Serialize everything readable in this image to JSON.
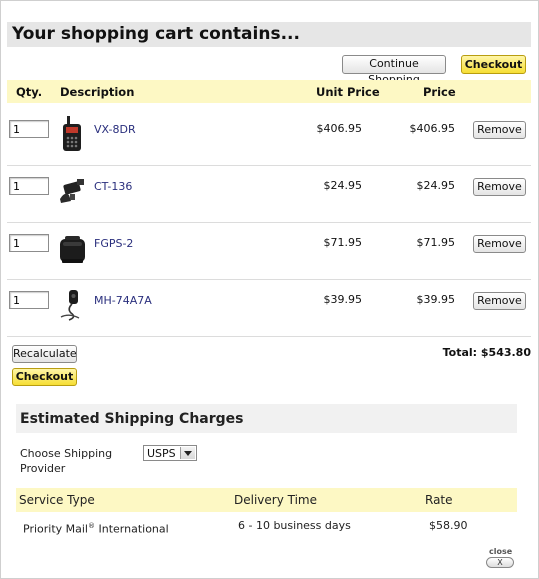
{
  "header": {
    "title": "Your shopping cart contains..."
  },
  "toolbar": {
    "continue_label": "Continue Shopping",
    "checkout_label": "Checkout"
  },
  "columns": {
    "qty": "Qty.",
    "description": "Description",
    "unit_price": "Unit Price",
    "price": "Price"
  },
  "items": [
    {
      "qty": "1",
      "name": "VX-8DR",
      "unit_price": "$406.95",
      "price": "$406.95",
      "remove": "Remove",
      "icon": "handheld-radio-icon"
    },
    {
      "qty": "1",
      "name": "CT-136",
      "unit_price": "$24.95",
      "price": "$24.95",
      "remove": "Remove",
      "icon": "adapter-icon"
    },
    {
      "qty": "1",
      "name": "FGPS-2",
      "unit_price": "$71.95",
      "price": "$71.95",
      "remove": "Remove",
      "icon": "gps-unit-icon"
    },
    {
      "qty": "1",
      "name": "MH-74A7A",
      "unit_price": "$39.95",
      "price": "$39.95",
      "remove": "Remove",
      "icon": "speaker-mic-icon"
    }
  ],
  "actions": {
    "recalculate_label": "Recalculate",
    "checkout_label": "Checkout"
  },
  "total": {
    "label": "Total:",
    "value": "$543.80"
  },
  "shipping": {
    "title": "Estimated Shipping Charges",
    "provider_label": "Choose Shipping Provider",
    "provider_value": "USPS",
    "columns": {
      "service": "Service Type",
      "delivery": "Delivery Time",
      "rate": "Rate"
    },
    "rows": [
      {
        "service": "Priority Mail",
        "service_sup": "®",
        "service_suffix": " International",
        "delivery": "6 - 10 business days",
        "rate": "$58.90"
      }
    ]
  },
  "close": {
    "label": "close",
    "button": "X"
  },
  "colors": {
    "accent_yellow": "#f6de34",
    "header_yellow": "#fdf8c4",
    "link": "#2a2f7d"
  }
}
